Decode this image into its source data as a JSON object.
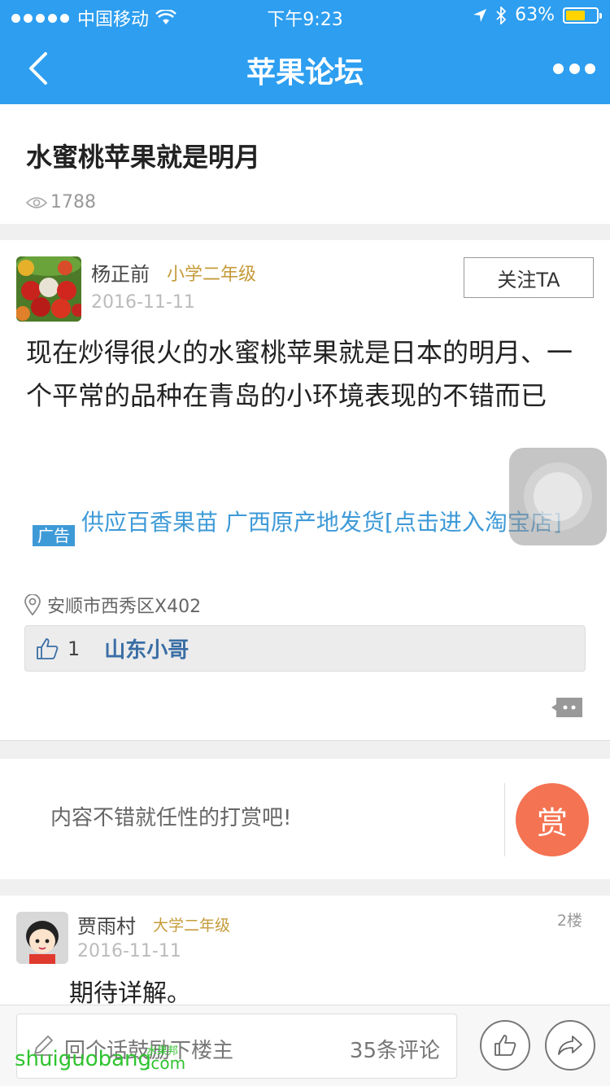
{
  "status_bar": {
    "carrier": "中国移动",
    "time": "下午9:23",
    "battery": "63%",
    "battery_level": 0.63
  },
  "nav": {
    "title": "苹果论坛",
    "back_icon": "chevron-left-icon",
    "more_icon": "more-dots-icon"
  },
  "post": {
    "title": "水蜜桃苹果就是明月",
    "views": "1788",
    "author": "杨正前",
    "grade": "小学二年级",
    "date": "2016-11-11",
    "follow_label": "关注TA",
    "content": "现在炒得很火的水蜜桃苹果就是日本的明月、一个平常的品种在青岛的小环境表现的不错而已",
    "ad_badge": "广告",
    "ad_text": "供应百香果苗 广西原产地发货[点击进入淘宝店]",
    "location": "安顺市西秀区X402",
    "like_count": "1",
    "liker": "山东小哥"
  },
  "reward": {
    "prompt": "内容不错就任性的打赏吧!",
    "button_label": "赏"
  },
  "reply": {
    "author": "贾雨村",
    "grade": "大学二年级",
    "floor": "2楼",
    "date": "2016-11-11",
    "content": "期待详解。"
  },
  "bottom_bar": {
    "placeholder": "回个话鼓励下楼主",
    "comment_count": "35条评论"
  },
  "watermark": {
    "text": "shuiguobang",
    "small": "水果邦",
    "suffix": ".com"
  },
  "colors": {
    "nav_bg": "#2d9ef0",
    "accent_link": "#3e9ad7",
    "grade_gold": "#c69c3a",
    "reward_red": "#f47352"
  }
}
